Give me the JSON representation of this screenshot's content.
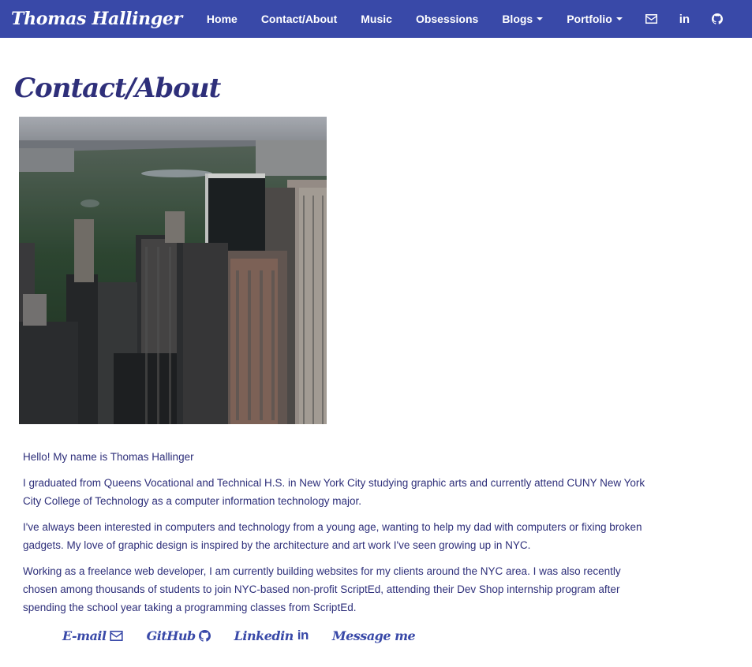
{
  "nav": {
    "brand": "Thomas Hallinger",
    "items": [
      {
        "label": "Home"
      },
      {
        "label": "Contact/About"
      },
      {
        "label": "Music"
      },
      {
        "label": "Obsessions"
      },
      {
        "label": "Blogs"
      },
      {
        "label": "Portfolio"
      }
    ],
    "icons": [
      "mail-icon",
      "linkedin-icon",
      "github-icon"
    ],
    "linkedin_text": "in",
    "color": "#3949a8"
  },
  "page": {
    "title": "Contact/About",
    "paragraphs": [
      "Hello! My name is Thomas Hallinger",
      "I graduated from Queens Vocational and Technical H.S. in New York City studying graphic arts and currently attend CUNY New York City College of Technology as a computer information technology major.",
      "I've always been interested in computers and technology from a young age, wanting to help my dad with computers or fixing broken gadgets. My love of graphic design is inspired by the architecture and art work I've seen growing up in NYC.",
      "Working as a freelance web developer, I am currently building websites for my clients around the NYC area. I was also recently chosen among thousands of students to join NYC-based non-profit ScriptEd, attending their Dev Shop internship program after spending the school year taking a programming classes from ScriptEd."
    ]
  },
  "links": {
    "email": "E-mail",
    "github": "GitHub",
    "linkedin": "Linkedin",
    "linkedin_icon_text": "in",
    "message": "Message me"
  },
  "colors": {
    "text": "#2e2f7a",
    "accent": "#3949a8"
  }
}
